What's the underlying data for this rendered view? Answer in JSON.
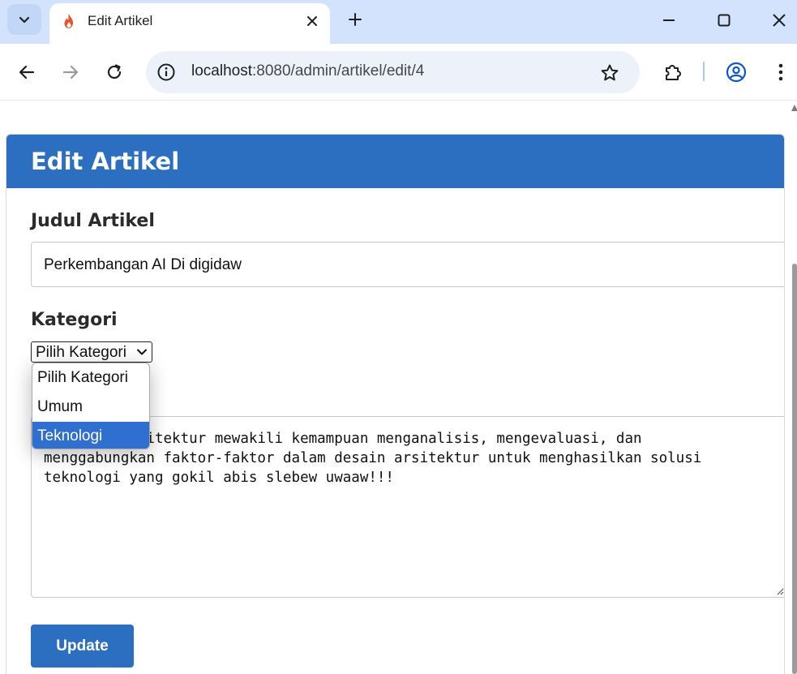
{
  "browser": {
    "tab_title": "Edit Artikel",
    "url_host": "localhost",
    "url_path": ":8080/admin/artikel/edit/4",
    "icons": [
      "tab-search-icon",
      "flame-favicon-icon",
      "close-icon",
      "plus-icon",
      "minimize-icon",
      "maximize-icon",
      "window-close-icon",
      "back-arrow-icon",
      "forward-arrow-icon",
      "reload-icon",
      "site-info-icon",
      "bookmark-star-icon",
      "extensions-icon",
      "profile-icon",
      "more-menu-icon"
    ]
  },
  "page": {
    "header_title": "Edit Artikel",
    "judul_label": "Judul Artikel",
    "judul_value": "Perkembangan AI Di digidaw",
    "kategori_label": "Kategori",
    "kategori_selected": "Pilih Kategori",
    "kategori_options": [
      "Pilih Kategori",
      "Umum",
      "Teknologi"
    ],
    "kategori_highlighted": "Teknologi",
    "content_lines": [
      "Berpikir arsitektur mewakili kemampuan menganalisis, mengevaluasi, dan",
      "menggabungkan faktor-faktor dalam desain arsitektur untuk menghasilkan solusi",
      "teknologi yang gokil abis slebew uwaaw!!!"
    ],
    "update_label": "Update"
  },
  "colors": {
    "brand": "#2c6fc0",
    "tabstrip": "#d3e3fd",
    "option_highlight": "#2f6fd0"
  }
}
